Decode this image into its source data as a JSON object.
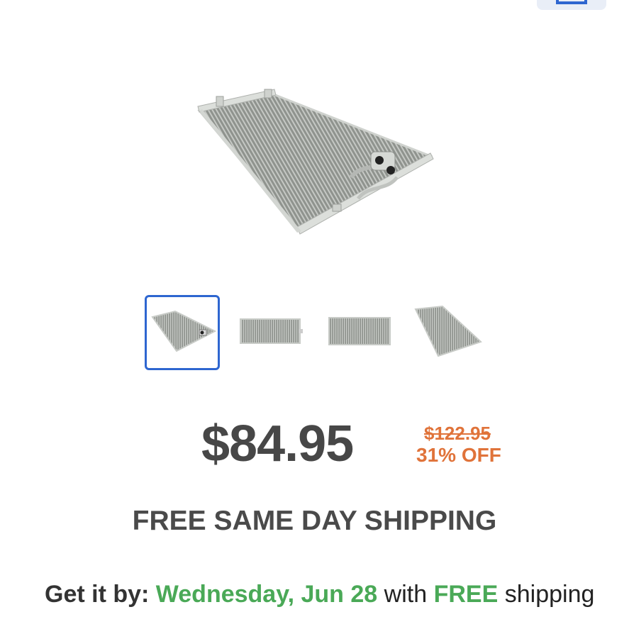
{
  "colors": {
    "accent_blue": "#2e66d0",
    "price_gray": "#474747",
    "discount_orange": "#e0733a",
    "delivery_green": "#4aa957"
  },
  "gallery": {
    "main_image": "condenser-radiator-image",
    "thumbnails": [
      {
        "icon": "condenser-angle-view",
        "selected": true
      },
      {
        "icon": "condenser-front-view",
        "selected": false
      },
      {
        "icon": "condenser-rear-view",
        "selected": false
      },
      {
        "icon": "condenser-side-view",
        "selected": false
      }
    ]
  },
  "pricing": {
    "price": "$84.95",
    "original_price": "$122.95",
    "discount": "31% OFF"
  },
  "shipping": {
    "banner": "FREE SAME DAY SHIPPING",
    "delivery_label": "Get it by:",
    "delivery_date": "Wednesday, Jun 28",
    "delivery_with": "with",
    "delivery_free": "FREE",
    "delivery_shipping": "shipping"
  }
}
